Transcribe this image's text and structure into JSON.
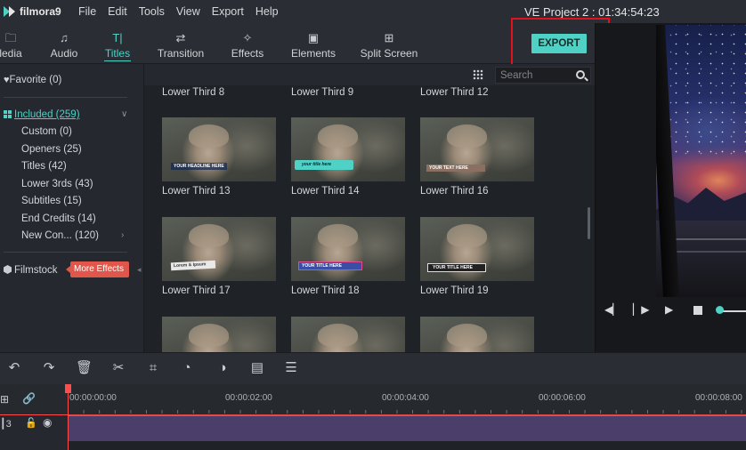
{
  "app": {
    "name": "filmora",
    "version": "9"
  },
  "menu": [
    "File",
    "Edit",
    "Tools",
    "View",
    "Export",
    "Help"
  ],
  "project": {
    "title": "VE Project 2 : 01:34:54:23"
  },
  "tabs": [
    {
      "label": "Media",
      "visible_label": "ledia",
      "icon": "folder-icon"
    },
    {
      "label": "Audio",
      "icon": "music-note-icon"
    },
    {
      "label": "Titles",
      "icon": "title-icon",
      "active": true
    },
    {
      "label": "Transition",
      "icon": "transition-icon"
    },
    {
      "label": "Effects",
      "icon": "effects-icon"
    },
    {
      "label": "Elements",
      "icon": "elements-icon"
    },
    {
      "label": "Split Screen",
      "icon": "split-screen-icon"
    }
  ],
  "export": {
    "label": "EXPORT"
  },
  "sidebar": {
    "favorite": "Favorite (0)",
    "included": "Included (259)",
    "items": [
      "Custom (0)",
      "Openers (25)",
      "Titles (42)",
      "Lower 3rds (43)",
      "Subtitles (15)",
      "End Credits (14)",
      "New Con... (120)"
    ],
    "filmstock": "Filmstock",
    "more_effects": "More Effects"
  },
  "search": {
    "placeholder": "Search"
  },
  "grid": {
    "top_labels": [
      "Lower Third 8",
      "Lower Third 9",
      "Lower Third 12"
    ],
    "rows": [
      [
        {
          "label": "Lower Third 13",
          "overlay": "YOUR HEADLINE HERE"
        },
        {
          "label": "Lower Third 14",
          "overlay": "your title here"
        },
        {
          "label": "Lower Third 16",
          "overlay": "YOUR TEXT HERE"
        }
      ],
      [
        {
          "label": "Lower Third 17",
          "overlay": "Lorem & Ipsum"
        },
        {
          "label": "Lower Third 18",
          "overlay": "YOUR TITLE HERE"
        },
        {
          "label": "Lower Third 19",
          "overlay": "YOUR TITLE HERE"
        }
      ]
    ]
  },
  "timeline": {
    "timecodes": [
      "00:00:00:00",
      "00:00:02:00",
      "00:00:04:00",
      "00:00:06:00",
      "00:00:08:00"
    ],
    "track_number": "3"
  },
  "colors": {
    "accent": "#4fd1c5",
    "highlight": "#e0121b",
    "playhead": "#ff4d4d"
  }
}
